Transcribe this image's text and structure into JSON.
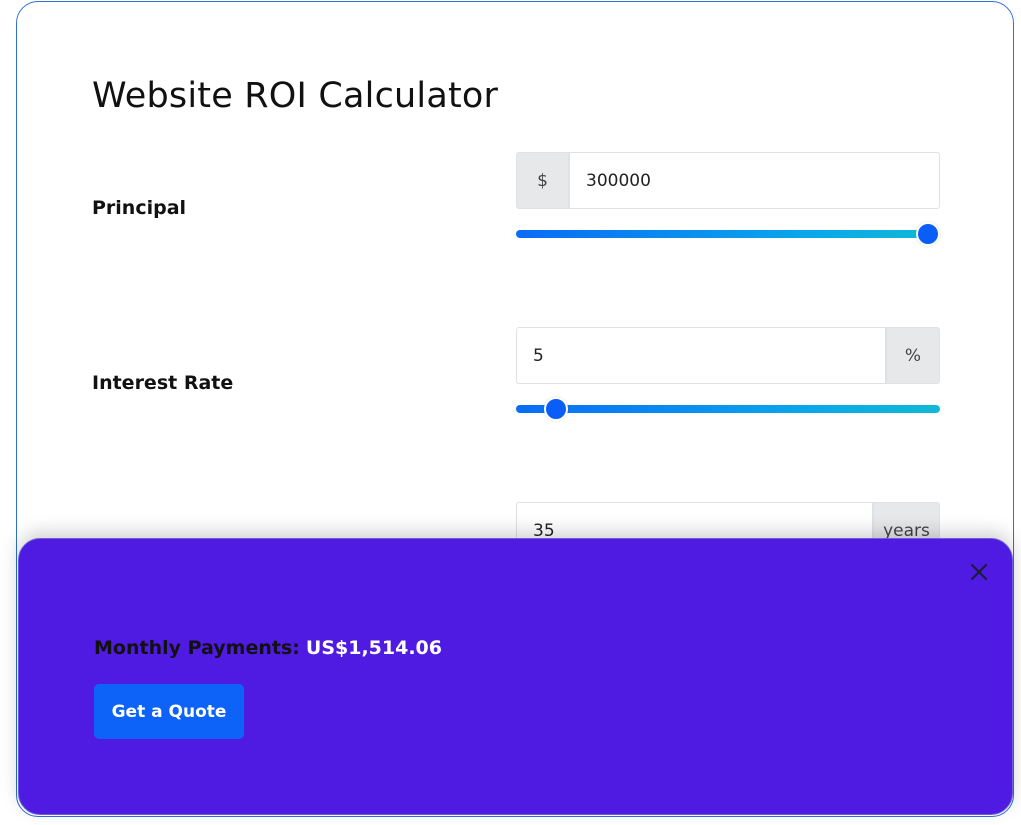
{
  "calculator": {
    "title": "Website ROI Calculator",
    "principal": {
      "label": "Principal",
      "prefix": "$",
      "value": "300000",
      "slider_fraction": 1.0
    },
    "interest_rate": {
      "label": "Interest Rate",
      "value": "5",
      "suffix": "%",
      "slider_fraction": 0.07
    },
    "term": {
      "value": "35",
      "suffix": "years"
    }
  },
  "result_panel": {
    "label": "Monthly Payments:",
    "value": "US$1,514.06",
    "cta_label": "Get a Quote",
    "background_color": "#4f1be3",
    "cta_color": "#0d63f8"
  },
  "colors": {
    "accent": "#0a5df6",
    "card_border": "#2f6fd6"
  }
}
